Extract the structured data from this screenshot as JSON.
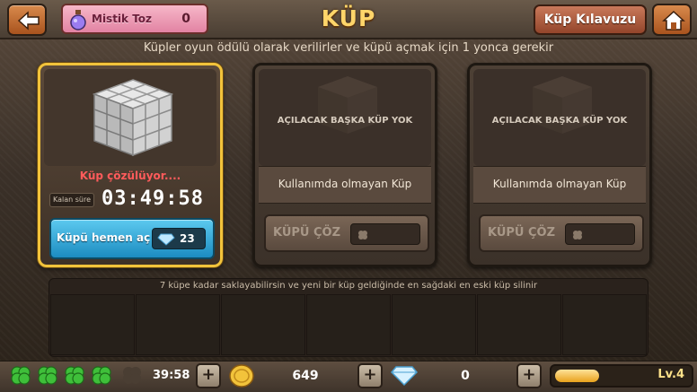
{
  "header": {
    "title": "KÜP",
    "mistik_label": "Mistik Toz",
    "mistik_count": "0",
    "guide_label": "Küp Kılavuzu",
    "back_icon": "back-arrow-icon",
    "home_icon": "home-icon"
  },
  "subtitle": "Küpler oyun ödülü olarak verilirler ve küpü açmak için 1 yonca gerekir",
  "cards": [
    {
      "state": "solving",
      "status": "Küp çözülüyor....",
      "time_label": "Kalan süre",
      "time": "03:49:58",
      "open_now_label": "Küpü hemen aç",
      "open_now_cost": "23"
    },
    {
      "state": "empty",
      "empty_text": "AÇILACAK BAŞKA KÜP YOK",
      "unused_text": "Kullanımda olmayan Küp",
      "solve_label": "KÜPÜ ÇÖZ"
    },
    {
      "state": "empty",
      "empty_text": "AÇILACAK BAŞKA KÜP YOK",
      "unused_text": "Kullanımda olmayan Küp",
      "solve_label": "KÜPÜ ÇÖZ"
    }
  ],
  "storage": {
    "note": "7 küpe kadar saklayabilirsin ve yeni bir küp geldiğinde en sağdaki en eski küp silinir"
  },
  "bottom": {
    "clover_timer": "39:58",
    "coins": "649",
    "gems": "0",
    "level": "Lv.4",
    "level_progress": 0.45
  },
  "colors": {
    "accent_gold": "#f2c33b",
    "open_button": "#1c8cc1",
    "solving_red": "#ff5b5b"
  }
}
